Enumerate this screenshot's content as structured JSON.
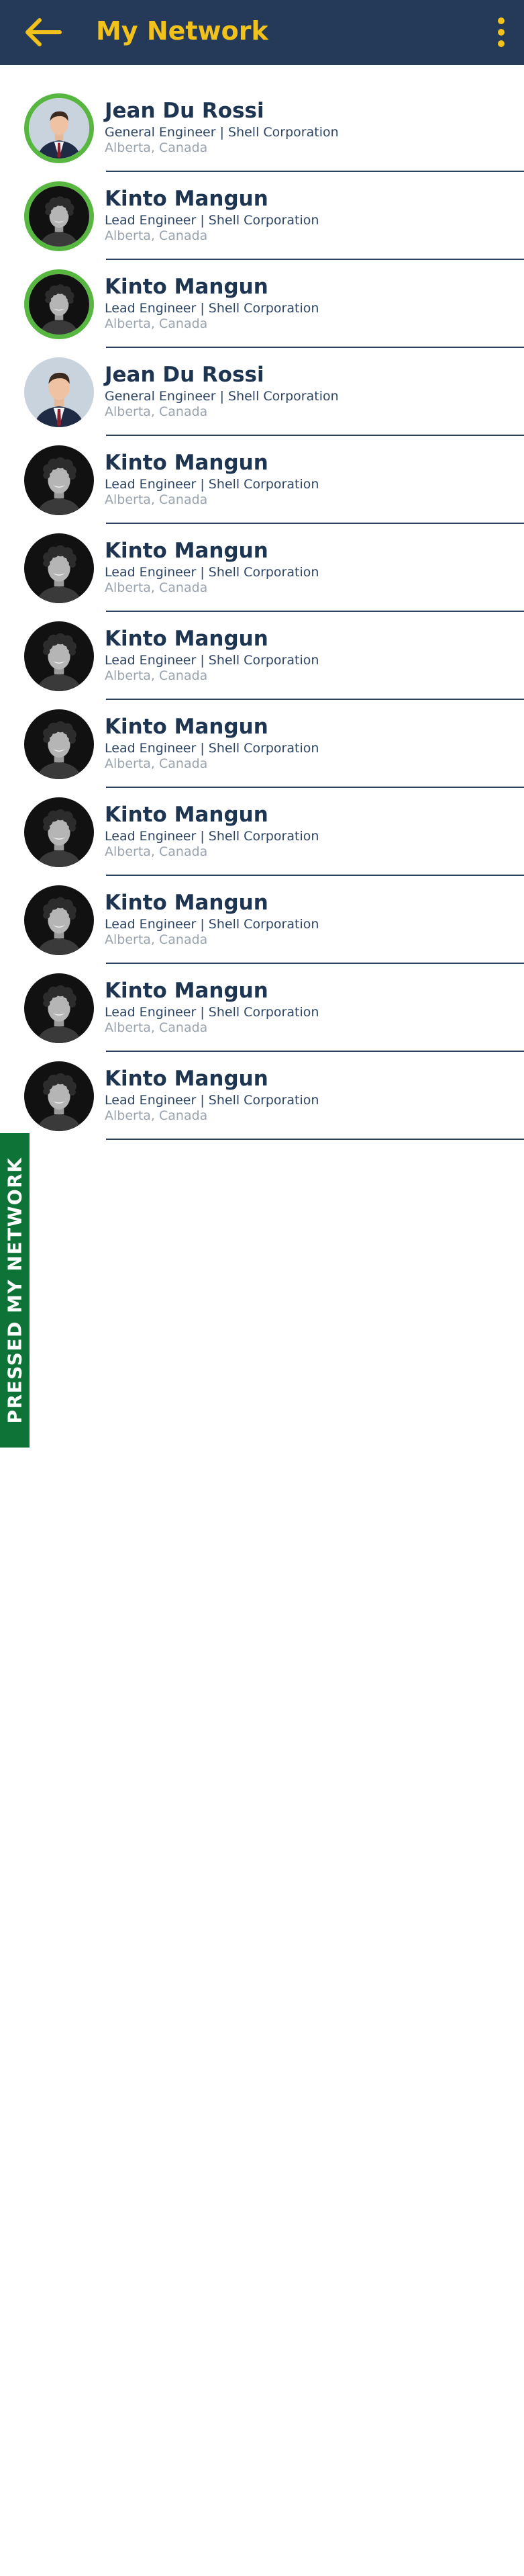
{
  "header": {
    "title": "My Network",
    "back_icon": "arrow-left-icon",
    "menu_icon": "more-vertical-icon"
  },
  "colors": {
    "header_bg": "#253a58",
    "title": "#f2c21b",
    "name": "#1e3552",
    "role": "#2d4463",
    "location": "#9aa4af",
    "ring": "#58b741",
    "side_tab": "#0d7337"
  },
  "contacts": [
    {
      "name": "Jean Du Rossi",
      "role": "General Engineer | Shell Corporation",
      "location": "Alberta, Canada",
      "avatar": "man-in-suit-avatar",
      "highlighted": true
    },
    {
      "name": "Kinto Mangun",
      "role": "Lead Engineer | Shell Corporation",
      "location": "Alberta, Canada",
      "avatar": "curly-hair-man-avatar",
      "highlighted": true
    },
    {
      "name": "Kinto Mangun",
      "role": "Lead Engineer | Shell Corporation",
      "location": "Alberta, Canada",
      "avatar": "curly-hair-man-avatar",
      "highlighted": true
    },
    {
      "name": "Jean Du Rossi",
      "role": "General Engineer | Shell Corporation",
      "location": "Alberta, Canada",
      "avatar": "man-in-suit-avatar",
      "highlighted": false
    },
    {
      "name": "Kinto Mangun",
      "role": "Lead Engineer | Shell Corporation",
      "location": "Alberta, Canada",
      "avatar": "curly-hair-man-avatar",
      "highlighted": false
    },
    {
      "name": "Kinto Mangun",
      "role": "Lead Engineer | Shell Corporation",
      "location": "Alberta, Canada",
      "avatar": "curly-hair-man-avatar",
      "highlighted": false
    },
    {
      "name": "Kinto Mangun",
      "role": "Lead Engineer | Shell Corporation",
      "location": "Alberta, Canada",
      "avatar": "curly-hair-man-avatar",
      "highlighted": false
    },
    {
      "name": "Kinto Mangun",
      "role": "Lead Engineer | Shell Corporation",
      "location": "Alberta, Canada",
      "avatar": "curly-hair-man-avatar",
      "highlighted": false
    },
    {
      "name": "Kinto Mangun",
      "role": "Lead Engineer | Shell Corporation",
      "location": "Alberta, Canada",
      "avatar": "curly-hair-man-avatar",
      "highlighted": false
    },
    {
      "name": "Kinto Mangun",
      "role": "Lead Engineer | Shell Corporation",
      "location": "Alberta, Canada",
      "avatar": "curly-hair-man-avatar",
      "highlighted": false
    },
    {
      "name": "Kinto Mangun",
      "role": "Lead Engineer | Shell Corporation",
      "location": "Alberta, Canada",
      "avatar": "curly-hair-man-avatar",
      "highlighted": false
    },
    {
      "name": "Kinto Mangun",
      "role": "Lead Engineer | Shell Corporation",
      "location": "Alberta, Canada",
      "avatar": "curly-hair-man-avatar",
      "highlighted": false
    }
  ],
  "side_tab": {
    "label": "PRESSED MY NETWORK"
  }
}
